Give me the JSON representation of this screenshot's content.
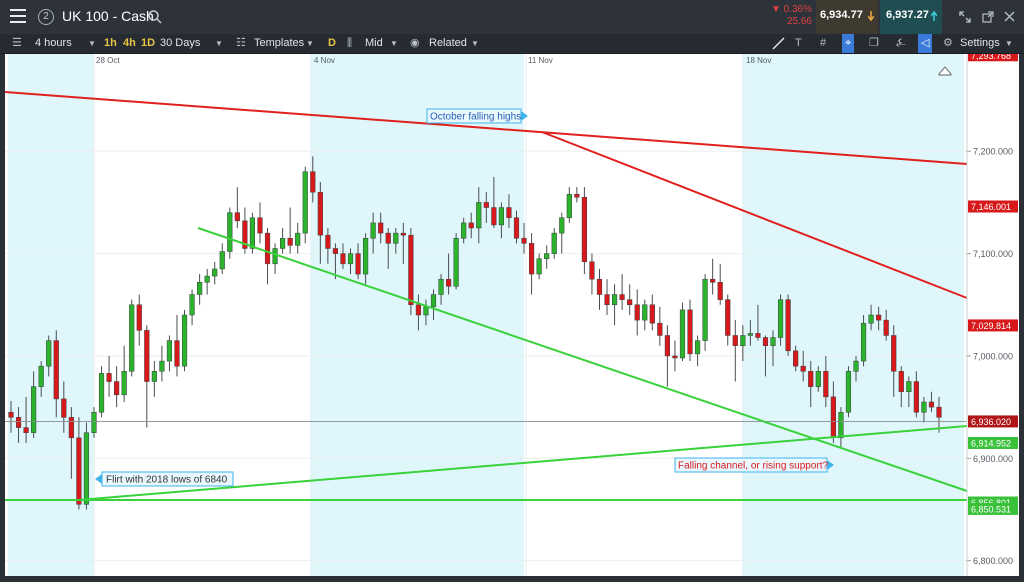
{
  "header": {
    "instrument": "UK 100 - Cash",
    "watch_count": "2",
    "change_pct": "▼ 0.36%",
    "change_pts": "25.66",
    "sell_price": "6,934.77",
    "buy_price": "6,937.27"
  },
  "toolbar": {
    "interval": "4 hours",
    "btn_1h": "1h",
    "btn_4h": "4h",
    "btn_1d": "1D",
    "period": "30 Days",
    "templates": "Templates",
    "btn_d": "D",
    "price_type": "Mid",
    "related": "Related",
    "settings": "Settings",
    "text_tool": "T"
  },
  "chart_data": {
    "type": "candlestick",
    "instrument": "UK 100 - Cash",
    "x_labels": [
      "28 Oct",
      "4 Nov",
      "11 Nov",
      "18 Nov"
    ],
    "y_ticks": [
      "7,200.000",
      "7,100.000",
      "7,000.000",
      "6,900.000",
      "6,800.000"
    ],
    "ylim": [
      6785,
      7295
    ],
    "price_labels": [
      {
        "text": "7,293.768",
        "value": 7293.768,
        "color": "#d8191c"
      },
      {
        "text": "7,146.001",
        "value": 7146.001,
        "color": "#d8191c"
      },
      {
        "text": "7,029.814",
        "value": 7029.814,
        "color": "#d8191c"
      },
      {
        "text": "6,936.020",
        "value": 6936.02,
        "color": "#b01518"
      },
      {
        "text": "6,914.952",
        "value": 6914.952,
        "color": "#39c13a"
      },
      {
        "text": "6,856.801",
        "value": 6856.801,
        "color": "#39c13a"
      },
      {
        "text": "6,850.531",
        "value": 6850.531,
        "color": "#39c13a"
      }
    ],
    "annotations": [
      {
        "text": "October falling highs",
        "color": "#2a5fb5"
      },
      {
        "text": "Flirt with 2018 lows of 6840",
        "color": "#333333"
      },
      {
        "text": "Falling channel, or rising support?",
        "color": "#d8191c"
      }
    ],
    "current_price": 6936.02,
    "candles": [
      [
        6945,
        6956,
        6925,
        6940
      ],
      [
        6940,
        6950,
        6915,
        6930
      ],
      [
        6930,
        6960,
        6915,
        6925
      ],
      [
        6925,
        6985,
        6920,
        6970
      ],
      [
        6970,
        6995,
        6960,
        6990
      ],
      [
        6990,
        7020,
        6980,
        7015
      ],
      [
        7015,
        7025,
        6940,
        6958
      ],
      [
        6958,
        6975,
        6925,
        6940
      ],
      [
        6940,
        6950,
        6880,
        6920
      ],
      [
        6920,
        6940,
        6850,
        6855
      ],
      [
        6855,
        6935,
        6850,
        6925
      ],
      [
        6925,
        6950,
        6920,
        6945
      ],
      [
        6945,
        6990,
        6940,
        6983
      ],
      [
        6983,
        7000,
        6960,
        6975
      ],
      [
        6975,
        6990,
        6950,
        6962
      ],
      [
        6962,
        7010,
        6955,
        6985
      ],
      [
        6985,
        7055,
        6980,
        7050
      ],
      [
        7050,
        7060,
        7010,
        7025
      ],
      [
        7025,
        7030,
        6930,
        6975
      ],
      [
        6975,
        6995,
        6960,
        6985
      ],
      [
        6985,
        7010,
        6975,
        6995
      ],
      [
        6995,
        7020,
        6985,
        7015
      ],
      [
        7015,
        7040,
        6980,
        6990
      ],
      [
        6990,
        7045,
        6985,
        7040
      ],
      [
        7040,
        7065,
        7030,
        7060
      ],
      [
        7060,
        7080,
        7050,
        7072
      ],
      [
        7072,
        7085,
        7060,
        7078
      ],
      [
        7078,
        7092,
        7070,
        7085
      ],
      [
        7085,
        7110,
        7080,
        7102
      ],
      [
        7102,
        7145,
        7095,
        7140
      ],
      [
        7140,
        7165,
        7125,
        7132
      ],
      [
        7132,
        7145,
        7100,
        7105
      ],
      [
        7105,
        7140,
        7100,
        7135
      ],
      [
        7135,
        7150,
        7110,
        7120
      ],
      [
        7120,
        7125,
        7070,
        7090
      ],
      [
        7090,
        7110,
        7080,
        7105
      ],
      [
        7105,
        7125,
        7100,
        7115
      ],
      [
        7115,
        7145,
        7100,
        7108
      ],
      [
        7108,
        7130,
        7100,
        7120
      ],
      [
        7120,
        7185,
        7110,
        7180
      ],
      [
        7180,
        7195,
        7150,
        7160
      ],
      [
        7160,
        7170,
        7090,
        7118
      ],
      [
        7118,
        7125,
        7090,
        7105
      ],
      [
        7105,
        7110,
        7075,
        7100
      ],
      [
        7100,
        7110,
        7085,
        7090
      ],
      [
        7090,
        7105,
        7080,
        7100
      ],
      [
        7100,
        7110,
        7075,
        7080
      ],
      [
        7080,
        7120,
        7070,
        7115
      ],
      [
        7115,
        7140,
        7100,
        7130
      ],
      [
        7130,
        7140,
        7110,
        7120
      ],
      [
        7120,
        7125,
        7085,
        7110
      ],
      [
        7110,
        7125,
        7100,
        7120
      ],
      [
        7120,
        7130,
        7090,
        7118
      ],
      [
        7118,
        7125,
        7040,
        7050
      ],
      [
        7050,
        7060,
        7025,
        7040
      ],
      [
        7040,
        7055,
        7030,
        7048
      ],
      [
        7048,
        7065,
        7035,
        7060
      ],
      [
        7060,
        7080,
        7050,
        7075
      ],
      [
        7075,
        7100,
        7060,
        7068
      ],
      [
        7068,
        7120,
        7065,
        7115
      ],
      [
        7115,
        7135,
        7110,
        7130
      ],
      [
        7130,
        7140,
        7115,
        7125
      ],
      [
        7125,
        7165,
        7110,
        7150
      ],
      [
        7150,
        7160,
        7130,
        7145
      ],
      [
        7145,
        7175,
        7125,
        7128
      ],
      [
        7128,
        7150,
        7115,
        7145
      ],
      [
        7145,
        7158,
        7125,
        7135
      ],
      [
        7135,
        7142,
        7110,
        7115
      ],
      [
        7115,
        7130,
        7100,
        7110
      ],
      [
        7110,
        7120,
        7060,
        7080
      ],
      [
        7080,
        7100,
        7075,
        7095
      ],
      [
        7095,
        7108,
        7085,
        7100
      ],
      [
        7100,
        7125,
        7095,
        7120
      ],
      [
        7120,
        7140,
        7100,
        7135
      ],
      [
        7135,
        7165,
        7130,
        7158
      ],
      [
        7158,
        7165,
        7150,
        7155
      ],
      [
        7155,
        7165,
        7080,
        7092
      ],
      [
        7092,
        7100,
        7060,
        7075
      ],
      [
        7075,
        7085,
        7045,
        7060
      ],
      [
        7060,
        7075,
        7040,
        7050
      ],
      [
        7050,
        7070,
        7030,
        7060
      ],
      [
        7060,
        7080,
        7045,
        7055
      ],
      [
        7055,
        7070,
        7040,
        7050
      ],
      [
        7050,
        7065,
        7020,
        7035
      ],
      [
        7035,
        7055,
        7025,
        7050
      ],
      [
        7050,
        7060,
        7025,
        7032
      ],
      [
        7032,
        7048,
        7010,
        7020
      ],
      [
        7020,
        7030,
        6970,
        7000
      ],
      [
        7000,
        7015,
        6985,
        6998
      ],
      [
        6998,
        7052,
        6995,
        7045
      ],
      [
        7045,
        7055,
        6995,
        7002
      ],
      [
        7002,
        7020,
        6990,
        7015
      ],
      [
        7015,
        7080,
        7005,
        7075
      ],
      [
        7075,
        7095,
        7060,
        7072
      ],
      [
        7072,
        7090,
        7050,
        7055
      ],
      [
        7055,
        7060,
        7010,
        7020
      ],
      [
        7020,
        7035,
        6975,
        7010
      ],
      [
        7010,
        7030,
        6995,
        7020
      ],
      [
        7020,
        7035,
        7010,
        7022
      ],
      [
        7022,
        7050,
        7015,
        7018
      ],
      [
        7018,
        7020,
        6980,
        7010
      ],
      [
        7010,
        7025,
        6990,
        7018
      ],
      [
        7018,
        7060,
        7010,
        7055
      ],
      [
        7055,
        7060,
        7000,
        7005
      ],
      [
        7005,
        7010,
        6985,
        6990
      ],
      [
        6990,
        7005,
        6975,
        6985
      ],
      [
        6985,
        6995,
        6950,
        6970
      ],
      [
        6970,
        6990,
        6965,
        6985
      ],
      [
        6985,
        7000,
        6950,
        6960
      ],
      [
        6960,
        6975,
        6915,
        6920
      ],
      [
        6920,
        6950,
        6910,
        6945
      ],
      [
        6945,
        6990,
        6940,
        6985
      ],
      [
        6985,
        7000,
        6975,
        6995
      ],
      [
        6995,
        7040,
        6990,
        7032
      ],
      [
        7032,
        7050,
        7025,
        7040
      ],
      [
        7040,
        7048,
        7025,
        7035
      ],
      [
        7035,
        7045,
        7015,
        7020
      ],
      [
        7020,
        7030,
        6960,
        6985
      ],
      [
        6985,
        6990,
        6950,
        6965
      ],
      [
        6965,
        6980,
        6950,
        6975
      ],
      [
        6975,
        6985,
        6940,
        6945
      ],
      [
        6945,
        6960,
        6935,
        6955
      ],
      [
        6955,
        6965,
        6945,
        6950
      ],
      [
        6950,
        6960,
        6925,
        6940
      ]
    ]
  }
}
